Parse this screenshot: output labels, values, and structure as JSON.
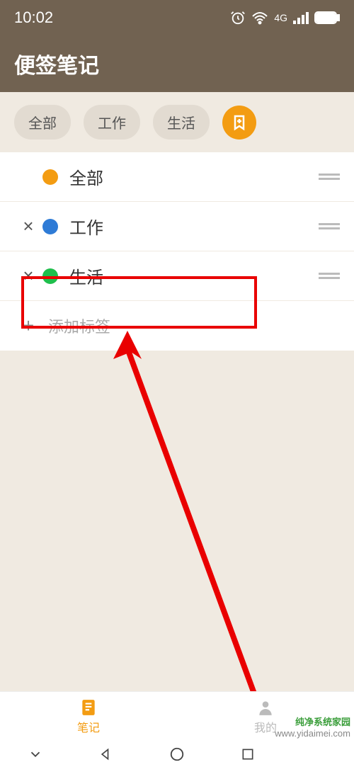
{
  "status": {
    "time": "10:02",
    "network": "4G"
  },
  "header": {
    "title": "便签笔记"
  },
  "filters": {
    "chips": [
      "全部",
      "工作",
      "生活"
    ]
  },
  "tags": [
    {
      "label": "全部",
      "color": "#f39c12",
      "deletable": false
    },
    {
      "label": "工作",
      "color": "#2e7bd6",
      "deletable": true
    },
    {
      "label": "生活",
      "color": "#1fbf4c",
      "deletable": true
    }
  ],
  "addTag": {
    "placeholder": "添加标签"
  },
  "bottomNav": {
    "notes": "笔记",
    "mine": "我的"
  },
  "watermark": {
    "brand": "纯净系统家园",
    "url": "www.yidaimei.com"
  }
}
